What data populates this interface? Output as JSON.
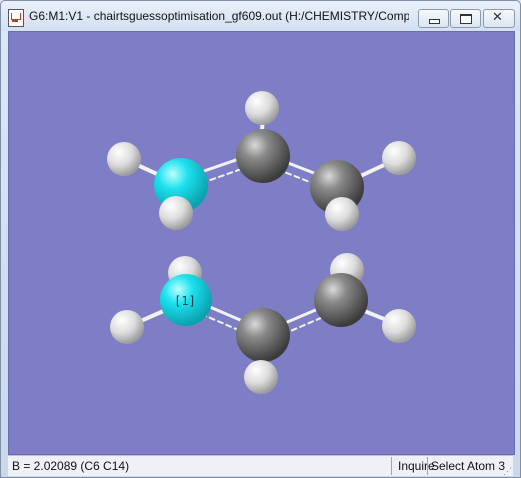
{
  "window": {
    "title": "G6:M1:V1 - chairtsguessoptimisation_gf609.out (H:/CHEMISTRY/Comp..."
  },
  "controls": {
    "minimize_icon": "minimize-icon",
    "maximize_icon": "maximize-icon",
    "close_icon": "close-icon",
    "close_glyph": "✕"
  },
  "viewer": {
    "background": "#7d7ec6",
    "atom_label": "[1]",
    "colors": {
      "carbon": "#6f6f6f",
      "nitrogen": "#19d9e6",
      "hydrogen": "#e8e8e8"
    }
  },
  "status": {
    "measurement": "B = 2.02089 (C6 C14)",
    "mode": "Inquire",
    "action": "Select Atom 3"
  }
}
